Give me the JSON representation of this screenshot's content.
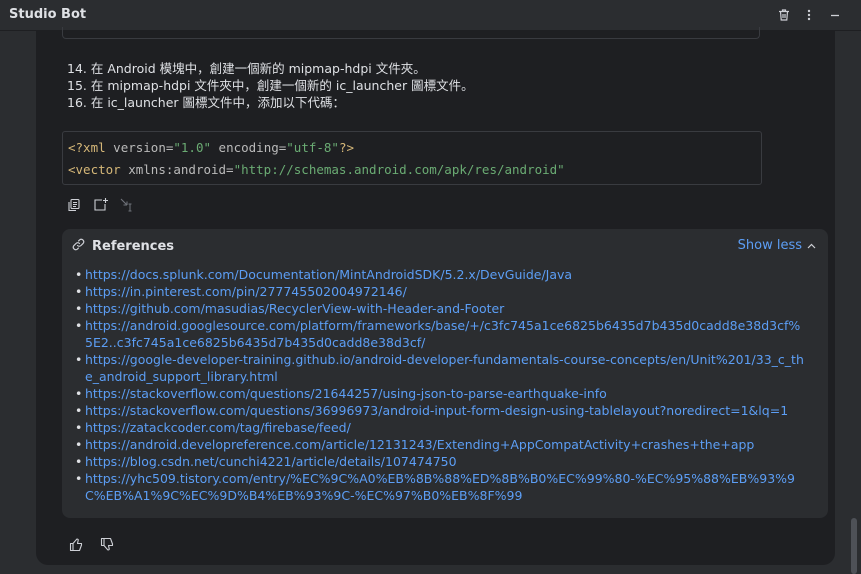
{
  "window": {
    "title": "Studio Bot"
  },
  "icons": {
    "delete": "trash-icon",
    "more": "kebab-icon",
    "minimize": "minimize-icon"
  },
  "steps": [
    "14. 在 Android 模塊中，創建一個新的 mipmap-hdpi 文件夾。",
    "15. 在 mipmap-hdpi 文件夾中，創建一個新的 ic_launcher 圖標文件。",
    "16. 在 ic_launcher 圖標文件中，添加以下代碼："
  ],
  "code": {
    "line1": {
      "open": "<?xml",
      "attr1": " version=",
      "val1": "\"1.0\"",
      "attr2": " encoding=",
      "val2": "\"utf-8\"",
      "close": "?>"
    },
    "line2": {
      "open": "<vector",
      "attr1": " xmlns:android=",
      "val1": "\"http://schemas.android.com/apk/res/android\""
    }
  },
  "references": {
    "title": "References",
    "toggle_label": "Show less",
    "items": [
      "https://docs.splunk.com/Documentation/MintAndroidSDK/5.2.x/DevGuide/Java",
      "https://in.pinterest.com/pin/277745502004972146/",
      "https://github.com/masudias/RecyclerView-with-Header-and-Footer",
      "https://android.googlesource.com/platform/frameworks/base/+/c3fc745a1ce6825b6435d7b435d0cadd8e38d3cf%5E2..c3fc745a1ce6825b6435d7b435d0cadd8e38d3cf/",
      "https://google-developer-training.github.io/android-developer-fundamentals-course-concepts/en/Unit%201/33_c_the_android_support_library.html",
      "https://stackoverflow.com/questions/21644257/using-json-to-parse-earthquake-info",
      "https://stackoverflow.com/questions/36996973/android-input-form-design-using-tablelayout?noredirect=1&lq=1",
      "https://zatackcoder.com/tag/firebase/feed/",
      "https://android.developreference.com/article/12131243/Extending+AppCompatActivity+crashes+the+app",
      "https://blog.csdn.net/cunchi4221/article/details/107474750",
      "https://yhc509.tistory.com/entry/%EC%9C%A0%EB%8B%88%ED%8B%B0%EC%99%80-%EC%95%88%EB%93%9C%EB%A1%9C%EC%9D%B4%EB%93%9C-%EC%97%B0%EB%8F%99"
    ]
  },
  "colors": {
    "accent": "#5c9ef5",
    "panel": "#1e1f22",
    "card": "#2b2d30",
    "text": "#dfe1e5"
  }
}
